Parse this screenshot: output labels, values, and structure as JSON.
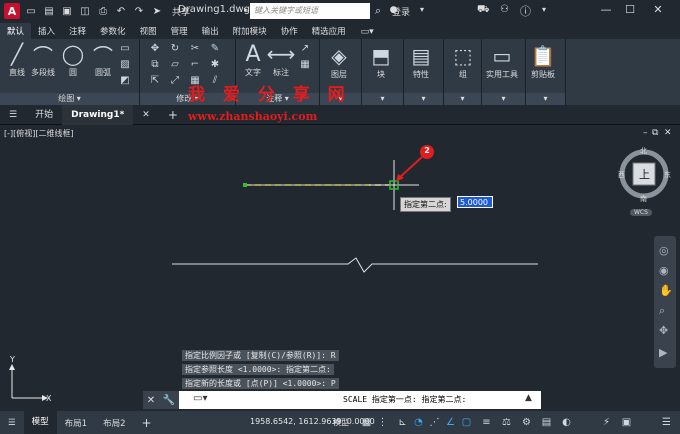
{
  "titlebar": {
    "logo": "A",
    "share_label": "共享",
    "doc_title": "Drawing1.dwg",
    "search_placeholder": "键入关键字或短语",
    "login_label": "登录"
  },
  "ribbon_tabs": [
    "默认",
    "插入",
    "注释",
    "参数化",
    "视图",
    "管理",
    "输出",
    "附加模块",
    "协作",
    "精选应用"
  ],
  "ribbon": {
    "draw_tools": [
      "直线",
      "多段线",
      "圆",
      "圆弧"
    ],
    "draw_panel": "绘图",
    "modify_panel": "修改",
    "text_tool": "文字",
    "dim_tool": "标注",
    "annot_panel": "注释",
    "layers": "图层",
    "block": "块",
    "properties": "特性",
    "group": "组",
    "utilities": "实用工具",
    "clipboard": "剪贴板"
  },
  "watermark": {
    "line1": "我 爱 分 享 网",
    "line2": "www.zhanshaoyi.com"
  },
  "doc_tabs": {
    "start": "开始",
    "active": "Drawing1*"
  },
  "viewport_label": "[-][俯视][二维线框]",
  "viewcube": {
    "top": "上",
    "north": "北",
    "south": "南",
    "east": "东",
    "west": "西",
    "wcs": "WCS"
  },
  "badge": "2",
  "dynamic_input": {
    "label": "指定第二点:",
    "value": "5.0000"
  },
  "command_history": [
    "指定比例因子或 [复制(C)/参照(R)]: R",
    "指定参照长度 <1.0000>:  指定第二点:",
    "指定新的长度或 [点(P)] <1.0000>:  P"
  ],
  "command_line": "SCALE 指定第一点:  指定第二点:",
  "status": {
    "tabs": [
      "模型",
      "布局1",
      "布局2"
    ],
    "coords": "1958.6542, 1612.9639, 0.0000",
    "model": "模型"
  },
  "colors": {
    "accent_red": "#c8102e",
    "dim_green": "#2fbf3a",
    "dash_yellow": "#d6c84a"
  }
}
